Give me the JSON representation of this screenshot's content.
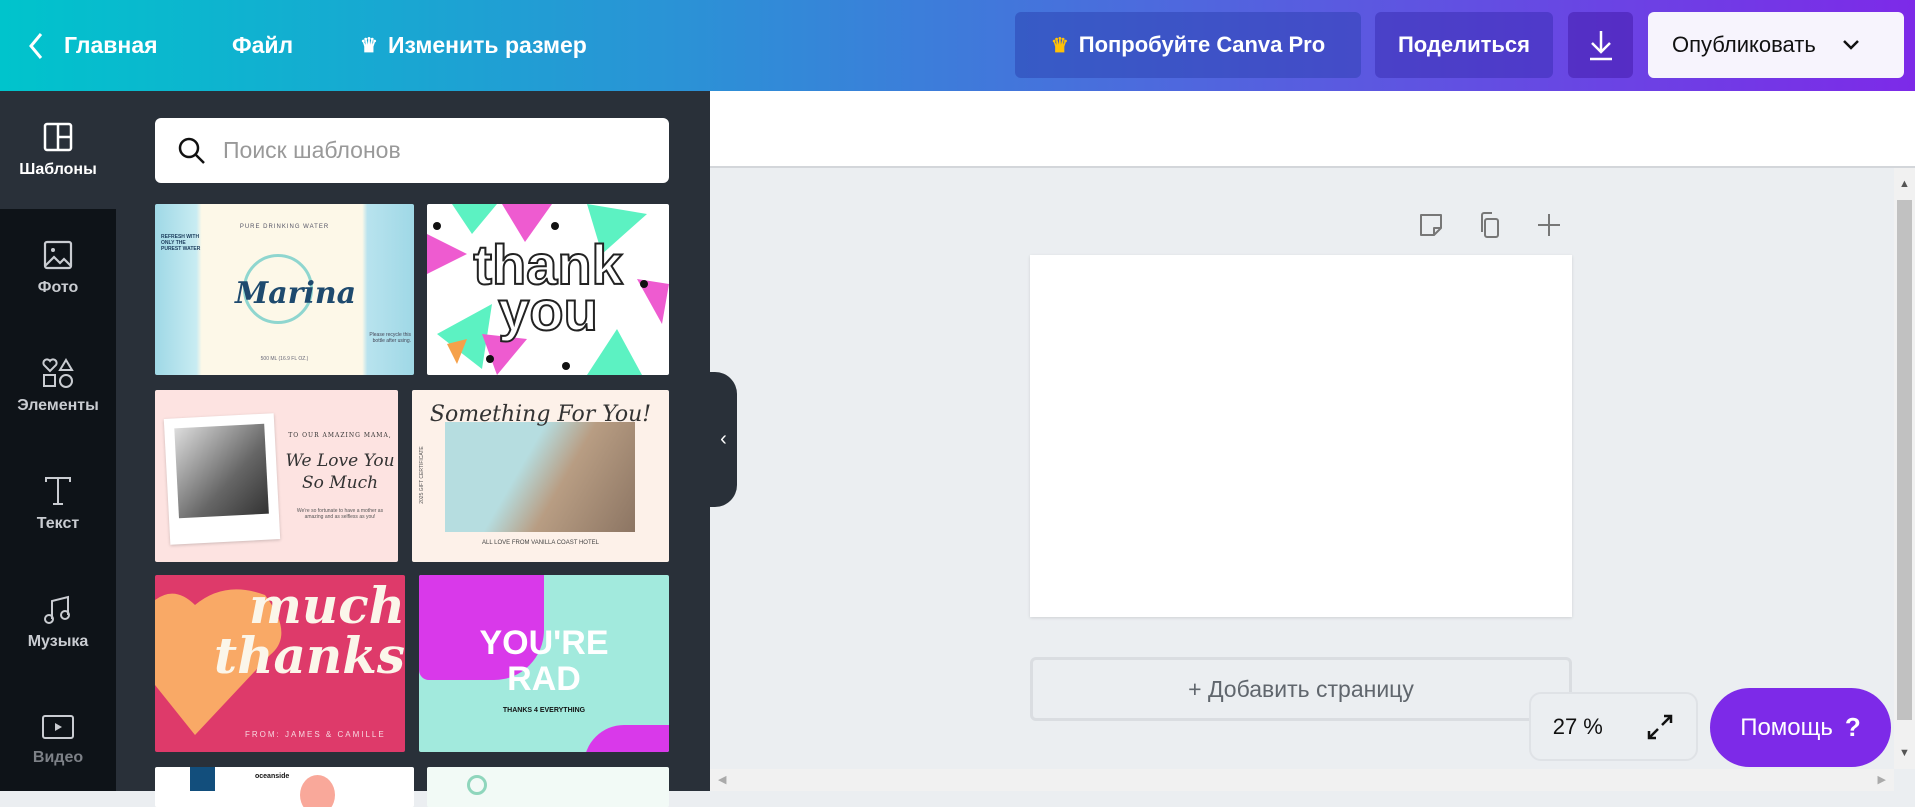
{
  "header": {
    "back_label": "Главная",
    "file_label": "Файл",
    "resize_label": "Изменить размер",
    "pro_label": "Попробуйте Canva Pro",
    "share_label": "Поделиться",
    "publish_label": "Опубликовать",
    "colors": {
      "gradient_start": "#00c4cc",
      "gradient_end": "#7d2ae8",
      "crown": "#ffc107"
    }
  },
  "sidebar": {
    "items": [
      {
        "label": "Шаблоны",
        "icon": "templates-icon",
        "active": true
      },
      {
        "label": "Фото",
        "icon": "photo-icon"
      },
      {
        "label": "Элементы",
        "icon": "elements-icon"
      },
      {
        "label": "Текст",
        "icon": "text-icon"
      },
      {
        "label": "Музыка",
        "icon": "music-icon"
      },
      {
        "label": "Видео",
        "icon": "video-icon"
      }
    ]
  },
  "search": {
    "placeholder": "Поиск шаблонов",
    "value": ""
  },
  "templates": [
    {
      "title": "Marina",
      "top": "PURE DRINKING WATER",
      "side": "REFRESH WITH ONLY THE PUREST WATER",
      "note": "Please recycle this bottle after using.",
      "bottom": "500 ML (16.9 FL OZ.)"
    },
    {
      "title": "thank",
      "title2": "you"
    },
    {
      "top": "TO OUR AMAZING MAMA,",
      "title": "We Love You",
      "title2": "So Much",
      "note": "We're so fortunate to have a mother as amazing and as selfless as you!"
    },
    {
      "title": "Something For You!",
      "side": "2025 GIFT CERTIFICATE",
      "bottom": "ALL LOVE FROM VANILLA COAST HOTEL"
    },
    {
      "title": "much",
      "title2": "thanks",
      "bottom": "FROM: JAMES & CAMILLE"
    },
    {
      "title": "YOU'RE",
      "title2": "RAD",
      "bottom": "THANKS 4 EVERYTHING"
    },
    {
      "title": "oceanside"
    },
    {
      "title": ""
    }
  ],
  "canvas": {
    "add_page_label": "+ Добавить страницу",
    "zoom_value": "27 %",
    "help_label": "Помощь",
    "help_icon": "?"
  }
}
